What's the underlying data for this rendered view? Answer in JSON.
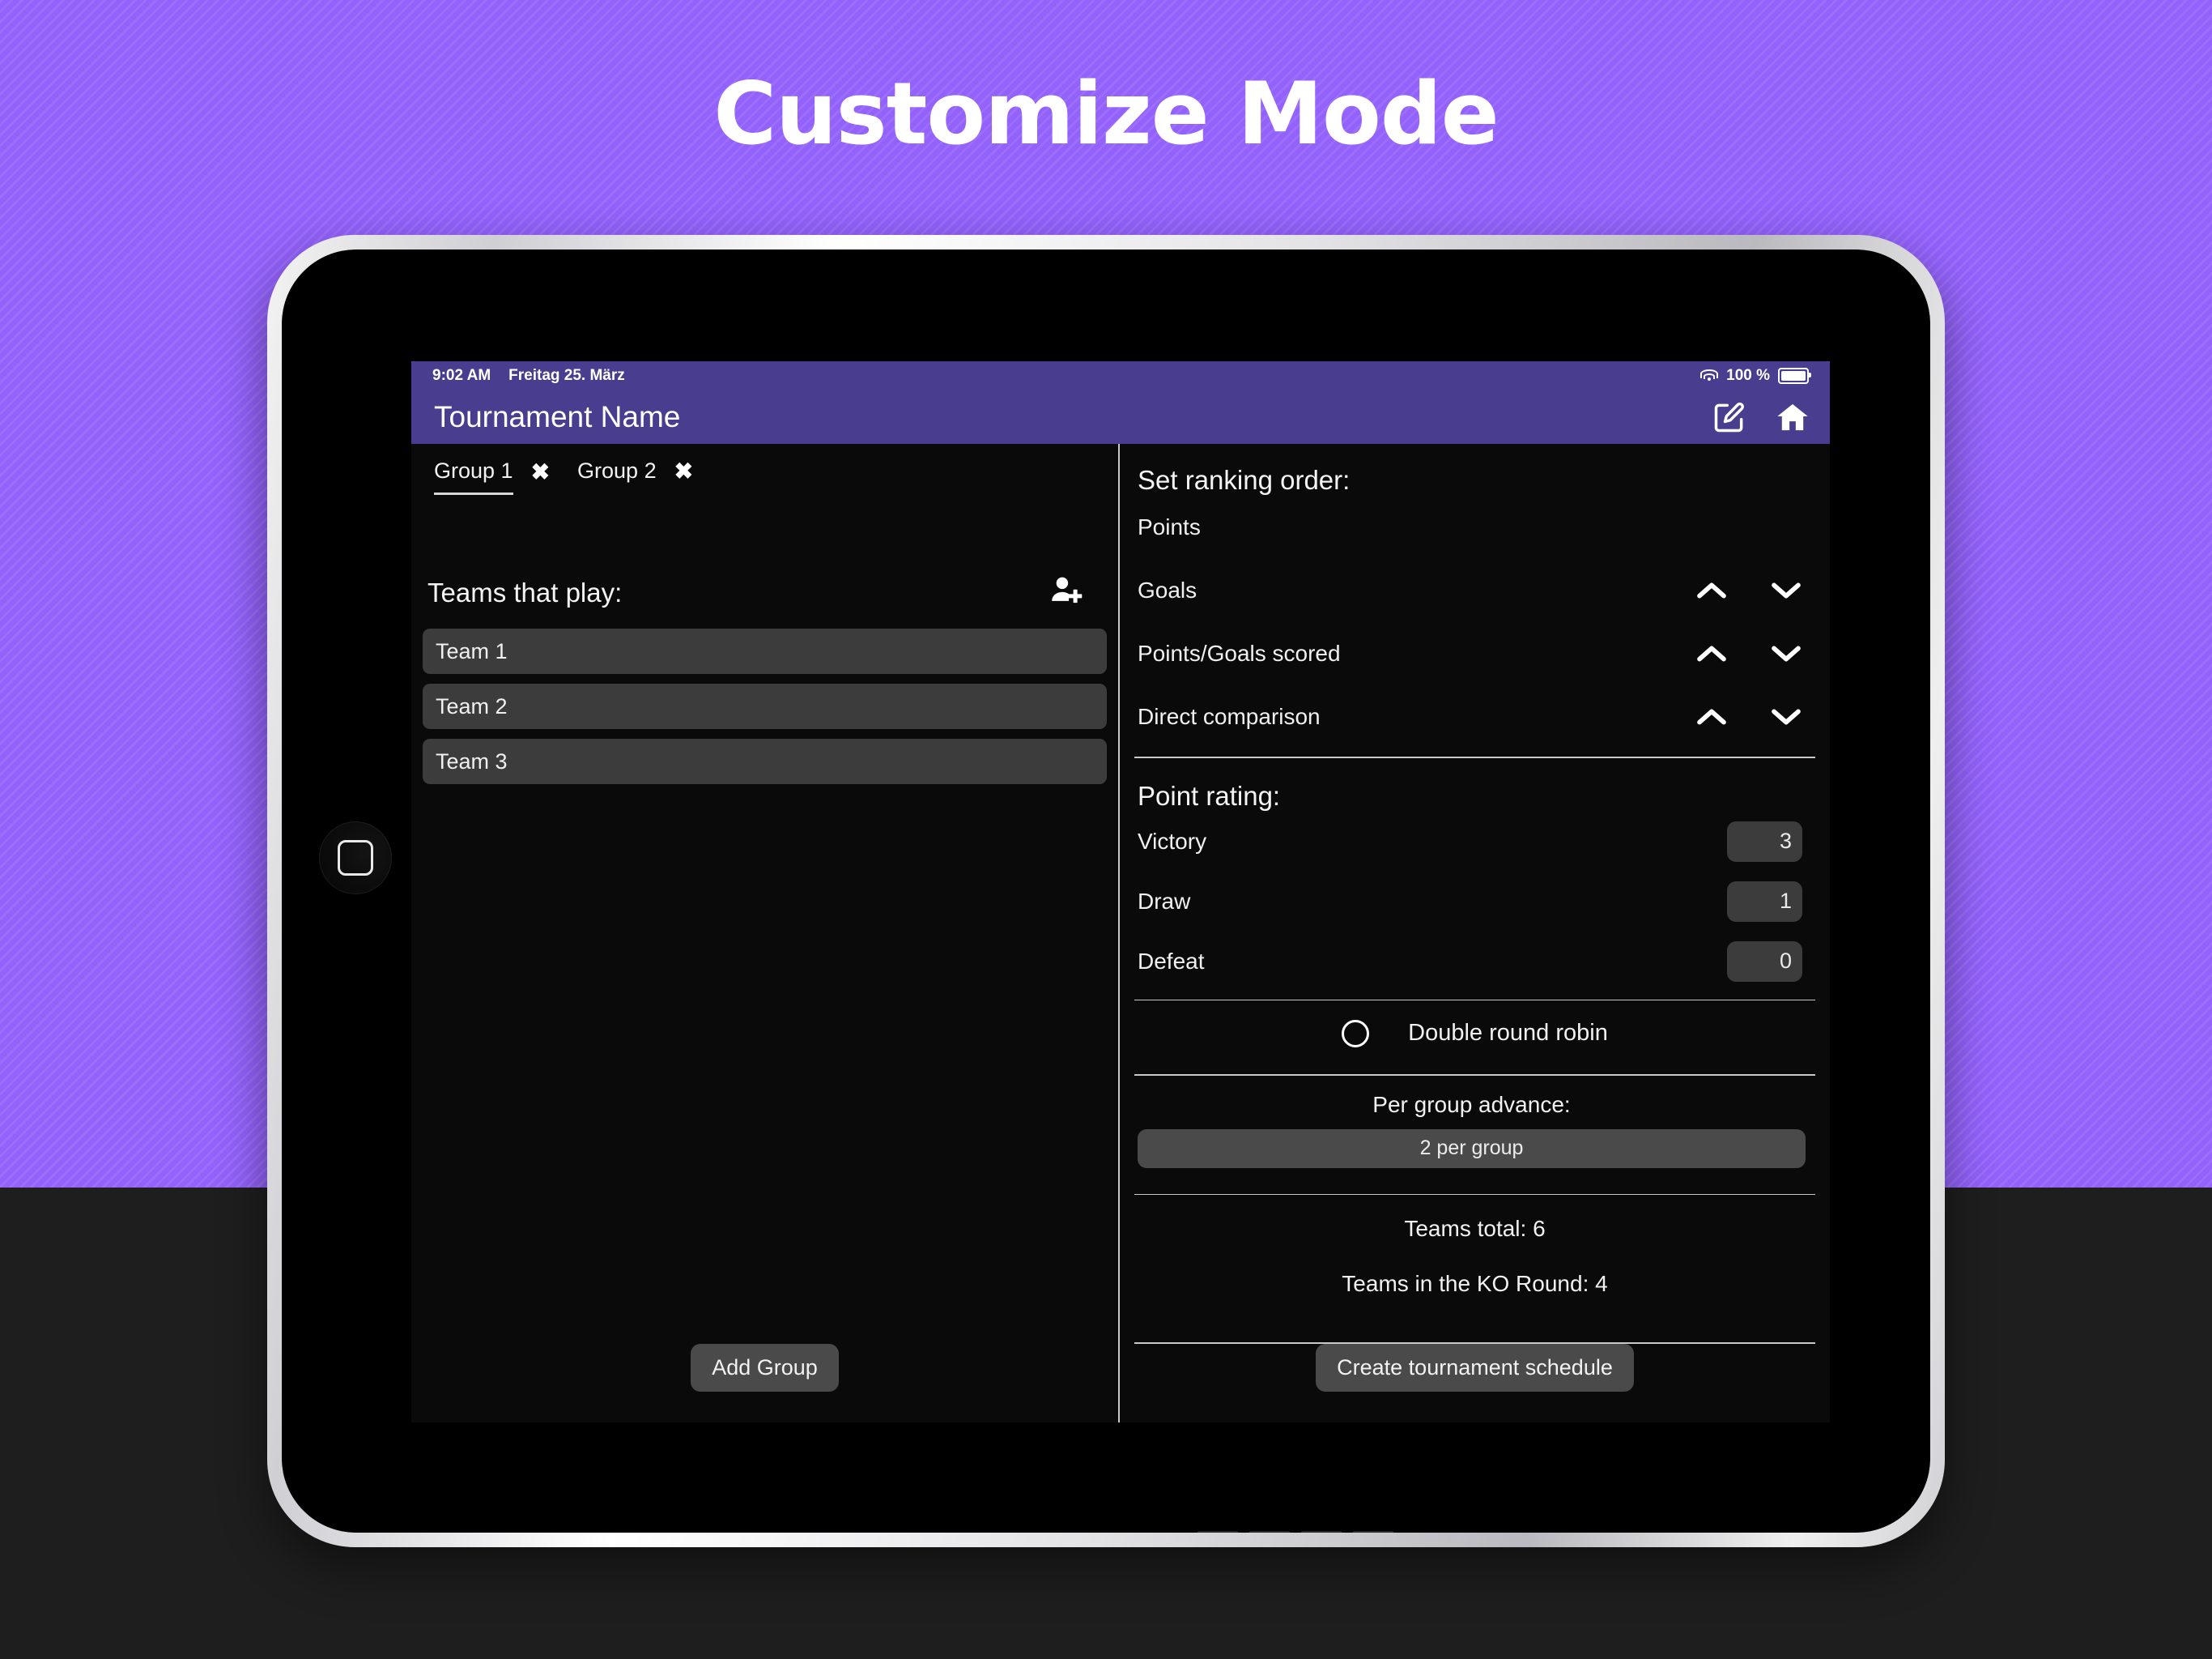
{
  "hero": {
    "title": "Customize Mode"
  },
  "device": {
    "home_button_icon": "rounded-square-home-icon"
  },
  "status_bar": {
    "time": "9:02 AM",
    "date": "Freitag 25. März",
    "wifi_icon": "wifi-icon",
    "battery_percent": "100 %",
    "battery_icon": "battery-full-icon"
  },
  "app_bar": {
    "title": "Tournament Name",
    "actions": [
      {
        "name": "edit-icon",
        "label": "Edit"
      },
      {
        "name": "home-icon",
        "label": "Home"
      }
    ],
    "color": "#493D8F"
  },
  "left_pane": {
    "tabs": [
      {
        "label": "Group 1",
        "active": true,
        "close_icon": "close-icon"
      },
      {
        "label": "Group 2",
        "active": false,
        "close_icon": "close-icon"
      }
    ],
    "teams_header": "Teams that play:",
    "add_team_icon": "add-person-icon",
    "teams": [
      "Team 1",
      "Team 2",
      "Team 3"
    ],
    "add_group_label": "Add Group"
  },
  "right_pane": {
    "ranking": {
      "title": "Set ranking order:",
      "items": [
        {
          "label": "Points",
          "has_arrows": false
        },
        {
          "label": "Goals",
          "has_arrows": true
        },
        {
          "label": "Points/Goals scored",
          "has_arrows": true
        },
        {
          "label": "Direct comparison",
          "has_arrows": true
        }
      ],
      "up_icon": "chevron-up-icon",
      "down_icon": "chevron-down-icon"
    },
    "point_rating": {
      "title": "Point rating:",
      "rows": [
        {
          "label": "Victory",
          "value": "3"
        },
        {
          "label": "Draw",
          "value": "1"
        },
        {
          "label": "Defeat",
          "value": "0"
        }
      ]
    },
    "double_round_robin": {
      "label": "Double round robin",
      "checked": false,
      "icon": "radio-unchecked-icon"
    },
    "per_group_advance": {
      "caption": "Per group advance:",
      "selected": "2 per group"
    },
    "totals": {
      "teams_total": "Teams total: 6",
      "teams_ko": "Teams in the KO Round: 4"
    },
    "create_schedule_label": "Create tournament schedule"
  },
  "colors": {
    "backdrop": "#9361FB",
    "lower_band": "#1E1E1E",
    "app_bar": "#493D8F",
    "surface": "#0A0A0A",
    "chip": "#3C3C3C",
    "button": "#4A4A4A"
  }
}
